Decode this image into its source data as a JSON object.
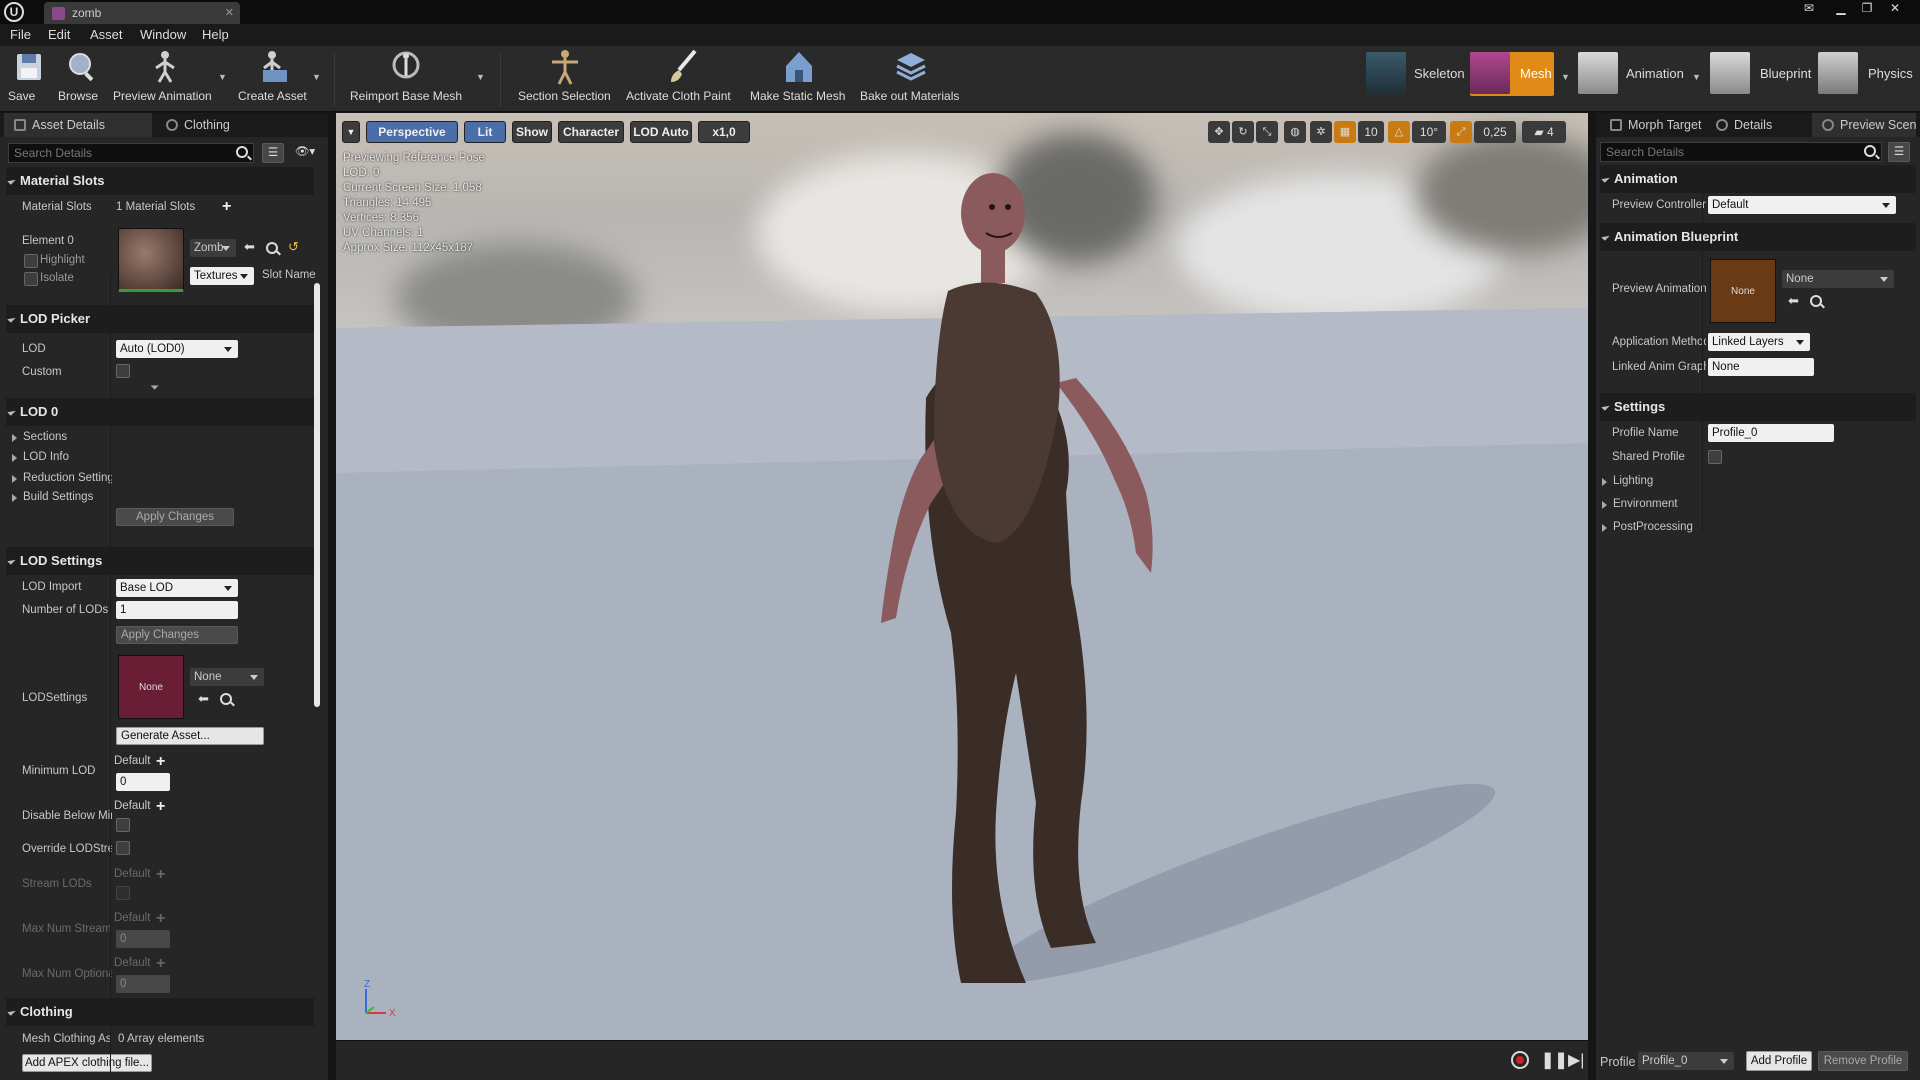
{
  "window": {
    "tab_title": "zomb",
    "logo": "ue-logo-icon"
  },
  "menu": [
    "File",
    "Edit",
    "Asset",
    "Window",
    "Help"
  ],
  "toolbar": {
    "save": "Save",
    "browse": "Browse",
    "preview_animation": "Preview Animation",
    "create_asset": "Create Asset",
    "reimport": "Reimport Base Mesh",
    "section_selection": "Section Selection",
    "cloth_paint": "Activate Cloth Paint",
    "static_mesh": "Make Static Mesh",
    "bake_materials": "Bake out Materials"
  },
  "modes": {
    "skeleton": "Skeleton",
    "mesh": "Mesh",
    "animation": "Animation",
    "blueprint": "Blueprint",
    "physics": "Physics"
  },
  "left_panel": {
    "tabs": [
      "Asset Details",
      "Clothing"
    ],
    "search_placeholder": "Search Details",
    "material_slots": {
      "title": "Material Slots",
      "label": "Material Slots",
      "value": "1 Material Slots",
      "element": "Element 0",
      "highlight": "Highlight",
      "isolate": "Isolate",
      "material": "Zomb",
      "textures": "Textures",
      "slot_name": "Slot Name"
    },
    "lod_picker": {
      "title": "LOD Picker",
      "lod_label": "LOD",
      "lod_value": "Auto (LOD0)",
      "custom": "Custom"
    },
    "lod0": {
      "title": "LOD 0",
      "sections": "Sections",
      "lod_info": "LOD Info",
      "reduction": "Reduction Settings",
      "build": "Build Settings",
      "apply": "Apply Changes"
    },
    "lod_settings": {
      "title": "LOD Settings",
      "import_label": "LOD Import",
      "import_value": "Base LOD",
      "num_label": "Number of LODs",
      "num_value": "1",
      "apply": "Apply Changes",
      "lodsettings_label": "LODSettings",
      "thumb_none": "None",
      "asset_value": "None",
      "generate": "Generate Asset...",
      "min_lod": "Minimum LOD",
      "default1": "Default",
      "min_value": "0",
      "disable_below": "Disable Below Min",
      "default2": "Default",
      "override": "Override LODStreaming",
      "stream_lods": "Stream LODs",
      "default3": "Default",
      "max_stream": "Max Num Streamed",
      "default4": "Default",
      "max_stream_value": "0",
      "max_optional": "Max Num Optional",
      "default5": "Default",
      "max_optional_value": "0"
    },
    "clothing": {
      "title": "Clothing",
      "assets_label": "Mesh Clothing Assets",
      "assets_value": "0 Array elements",
      "add_button": "Add APEX clothing file..."
    }
  },
  "viewport": {
    "perspective": "Perspective",
    "lit": "Lit",
    "show": "Show",
    "character": "Character",
    "lod": "LOD Auto",
    "speed": "x1,0",
    "grid_snap": "10",
    "rot_snap": "10°",
    "scale_snap": "0,25",
    "cam_speed": "4",
    "stats": [
      "Previewing Reference Pose",
      "LOD: 0",
      "Current Screen Size: 1,058",
      "Triangles: 14 495",
      "Vertices: 8 356",
      "UV Channels: 1",
      "Approx Size: 112x45x187"
    ],
    "axis_z": "Z",
    "axis_x": "X"
  },
  "right_panel": {
    "tabs": [
      "Morph Target Preview",
      "Details",
      "Preview Scene Settings"
    ],
    "search_placeholder": "Search Details",
    "animation": {
      "title": "Animation",
      "controller_label": "Preview Controller",
      "controller_value": "Default"
    },
    "anim_bp": {
      "title": "Animation Blueprint",
      "preview_label": "Preview Animation Blueprint",
      "thumb_none": "None",
      "value": "None",
      "app_label": "Application Method",
      "app_value": "Linked Layers",
      "linked_label": "Linked Anim Graph",
      "linked_value": "None"
    },
    "settings": {
      "title": "Settings",
      "profile_label": "Profile Name",
      "profile_value": "Profile_0",
      "shared_label": "Shared Profile",
      "lighting": "Lighting",
      "environment": "Environment",
      "postprocessing": "PostProcessing"
    },
    "bottom": {
      "profile_label": "Profile",
      "profile_value": "Profile_0",
      "add": "Add Profile",
      "remove": "Remove Profile"
    }
  },
  "colors": {
    "accent": "#e08a18",
    "panel": "#262626",
    "blue_button": "#4c6ea8"
  }
}
